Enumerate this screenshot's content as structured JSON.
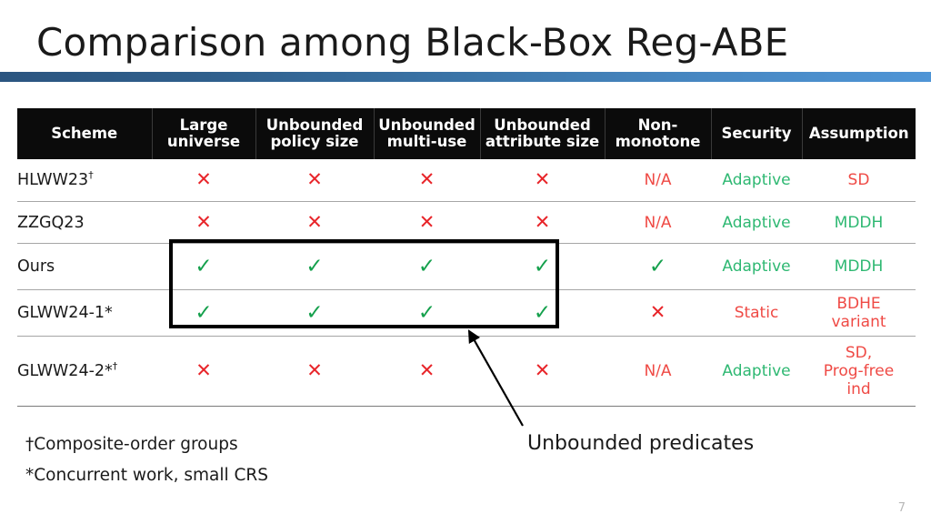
{
  "slide": {
    "title": "Comparison among Black-Box Reg-ABE",
    "page_number": "7",
    "accent_color_left": "#2b5580",
    "accent_color_right": "#4f95d6"
  },
  "table": {
    "columns": [
      "Scheme",
      "Large universe",
      "Unbounded policy size",
      "Unbounded multi-use",
      "Unbounded attribute size",
      "Non-monotone",
      "Security",
      "Assumption"
    ],
    "column_lines": [
      [
        "Scheme"
      ],
      [
        "Large",
        "universe"
      ],
      [
        "Unbounded",
        "policy size"
      ],
      [
        "Unbounded",
        "multi-use"
      ],
      [
        "Unbounded",
        "attribute size"
      ],
      [
        "Non-",
        "monotone"
      ],
      [
        "Security"
      ],
      [
        "Assumption"
      ]
    ],
    "rows": [
      {
        "scheme": "HLWW23",
        "scheme_sup": "†",
        "large_universe": "✕",
        "unbounded_policy_size": "✕",
        "unbounded_multi_use": "✕",
        "unbounded_attribute_size": "✕",
        "non_monotone": "N/A",
        "security": "Adaptive",
        "assumption": [
          "SD"
        ]
      },
      {
        "scheme": "ZZGQ23",
        "scheme_sup": "",
        "large_universe": "✕",
        "unbounded_policy_size": "✕",
        "unbounded_multi_use": "✕",
        "unbounded_attribute_size": "✕",
        "non_monotone": "N/A",
        "security": "Adaptive",
        "assumption": [
          "MDDH"
        ]
      },
      {
        "scheme": "Ours",
        "scheme_sup": "",
        "large_universe": "✓",
        "unbounded_policy_size": "✓",
        "unbounded_multi_use": "✓",
        "unbounded_attribute_size": "✓",
        "non_monotone": "✓",
        "security": "Adaptive",
        "assumption": [
          "MDDH"
        ]
      },
      {
        "scheme": "GLWW24-1*",
        "scheme_sup": "",
        "large_universe": "✓",
        "unbounded_policy_size": "✓",
        "unbounded_multi_use": "✓",
        "unbounded_attribute_size": "✓",
        "non_monotone": "✕",
        "security": "Static",
        "assumption": [
          "BDHE",
          "variant"
        ]
      },
      {
        "scheme": "GLWW24-2*",
        "scheme_sup": "†",
        "large_universe": "✕",
        "unbounded_policy_size": "✕",
        "unbounded_multi_use": "✕",
        "unbounded_attribute_size": "✕",
        "non_monotone": "N/A",
        "security": "Adaptive",
        "assumption": [
          "SD,",
          "Prog-free",
          "ind"
        ]
      }
    ]
  },
  "callout": {
    "label": "Unbounded predicates"
  },
  "footnotes": {
    "dagger": "†Composite-order groups",
    "asterisk": "*Concurrent work, small CRS"
  },
  "colors": {
    "check_green": "#14a04c",
    "cross_red": "#e8252a",
    "good_text_green": "#2eb872",
    "bad_text_red": "#ef4a45",
    "header_bg": "#0b0b0b"
  }
}
